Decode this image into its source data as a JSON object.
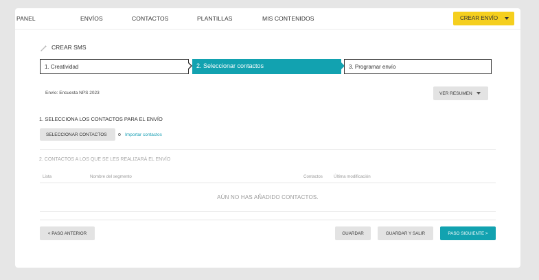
{
  "topnav": {
    "items": [
      {
        "label": "PANEL"
      },
      {
        "label": "ENVÍOS"
      },
      {
        "label": "CONTACTOS"
      },
      {
        "label": "PLANTILLAS"
      },
      {
        "label": "MIS CONTENIDOS"
      }
    ],
    "create_label": "CREAR ENVÍO",
    "create_color": "#f5cf1e"
  },
  "page": {
    "title": "CREAR SMS",
    "title_icon": "magic-wand-icon"
  },
  "steps": [
    {
      "label": "1. Creatividad",
      "state": "done"
    },
    {
      "label": "2. Seleccionar contactos",
      "state": "active"
    },
    {
      "label": "3. Programar envío",
      "state": "pending"
    }
  ],
  "accent_color": "#12a2b0",
  "envio": {
    "text": "Envío: Encuesta NPS 2023",
    "resumen_label": "VER RESUMEN"
  },
  "section1": {
    "title": "1. SELECCIONA LOS CONTACTOS PARA EL ENVÍO",
    "select_label": "SELECCIONAR CONTACTOS",
    "separator": "o",
    "import_label": "Importar contactos"
  },
  "section2": {
    "title": "2. CONTACTOS A LOS QUE SE LES REALIZARÁ EL ENVÍO",
    "columns": [
      "Lista",
      "Nombre del segmento",
      "Contactos",
      "Última modificación"
    ],
    "empty_message": "AÚN NO HAS AÑADIDO CONTACTOS."
  },
  "footer": {
    "prev_label": "< PASO ANTERIOR",
    "save_label": "GUARDAR",
    "save_exit_label": "GUARDAR Y SALIR",
    "next_label": "PASO SIGUIENTE >"
  }
}
